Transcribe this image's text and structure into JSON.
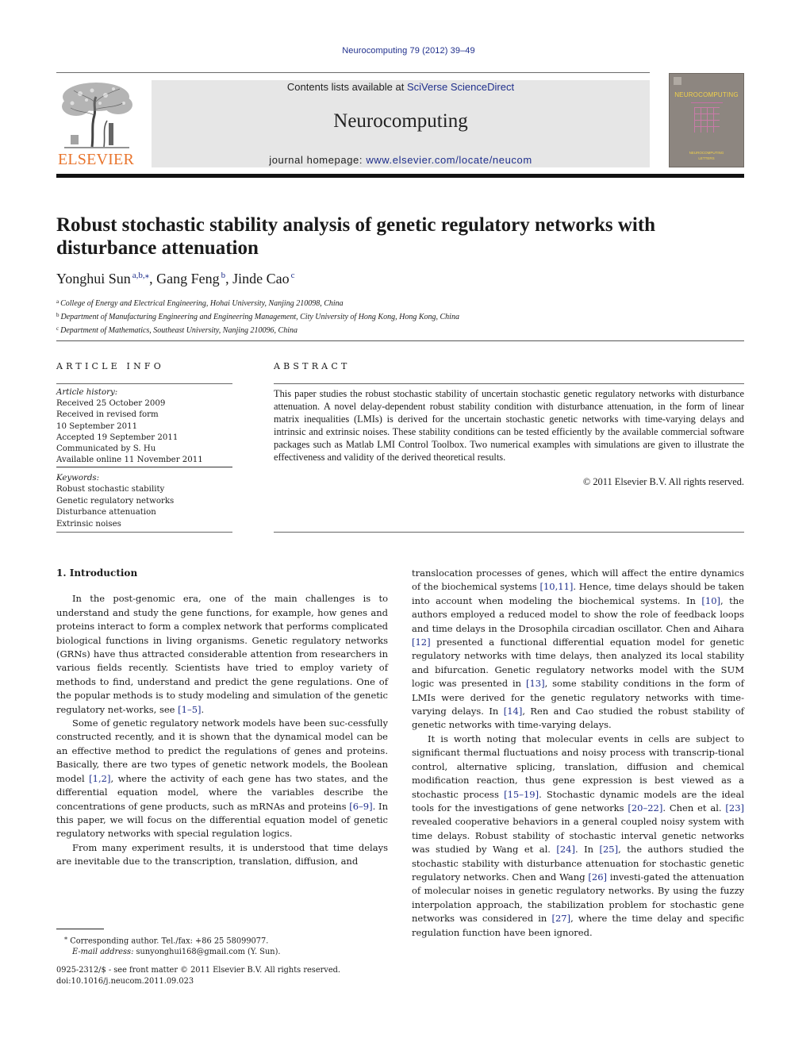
{
  "header": {
    "citation": "Neurocomputing 79 (2012) 39–49",
    "contents_prefix": "Contents lists available at ",
    "contents_link": "SciVerse ScienceDirect",
    "journal_name": "Neurocomputing",
    "homepage_prefix": "journal homepage: ",
    "homepage_link": "www.elsevier.com/locate/neucom",
    "publisher_logo_text": "ELSEVIER",
    "cover": {
      "title": "NEUROCOMPUTING",
      "subtitle_line1": "NEUROCOMPUTING",
      "subtitle_line2": "LETTERS"
    },
    "colors": {
      "link_blue": "#1f2f8c",
      "elsevier_orange": "#e8742c",
      "masthead_gray": "#e6e6e6"
    }
  },
  "article": {
    "title": "Robust stochastic stability analysis of genetic regulatory networks with disturbance attenuation",
    "authors": [
      {
        "name": "Yonghui Sun",
        "marks": "a,b,",
        "corresponding": "⁎"
      },
      {
        "name": "Gang Feng",
        "marks": "b"
      },
      {
        "name": "Jinde Cao",
        "marks": "c"
      }
    ],
    "affiliations": [
      {
        "mark": "a",
        "text": "College of Energy and Electrical Engineering, Hohai University, Nanjing 210098, China"
      },
      {
        "mark": "b",
        "text": "Department of Manufacturing Engineering and Engineering Management, City University of Hong Kong, Hong Kong, China"
      },
      {
        "mark": "c",
        "text": "Department of Mathematics, Southeast University, Nanjing 210096, China"
      }
    ]
  },
  "article_info": {
    "heading": "ARTICLE INFO",
    "history_label": "Article history:",
    "history": [
      "Received 25 October 2009",
      "Received in revised form",
      "10 September 2011",
      "Accepted 19 September 2011",
      "Communicated by S. Hu",
      "Available online 11 November 2011"
    ],
    "keywords_label": "Keywords:",
    "keywords": [
      "Robust stochastic stability",
      "Genetic regulatory networks",
      "Disturbance attenuation",
      "Extrinsic noises"
    ]
  },
  "abstract": {
    "heading": "ABSTRACT",
    "text": "This paper studies the robust stochastic stability of uncertain stochastic genetic regulatory networks with disturbance attenuation. A novel delay-dependent robust stability condition with disturbance attenuation, in the form of linear matrix inequalities (LMIs) is derived for the uncertain stochastic genetic networks with time-varying delays and intrinsic and extrinsic noises. These stability conditions can be tested efficiently by the available commercial software packages such as Matlab LMI Control Toolbox. Two numerical examples with simulations are given to illustrate the effectiveness and validity of the derived theoretical results.",
    "copyright": "© 2011 Elsevier B.V. All rights reserved."
  },
  "body": {
    "section_heading": "1.  Introduction",
    "left_paragraphs": [
      [
        {
          "t": "In the post-genomic era, one of the main challenges is to understand and study the gene functions, for example, how genes and proteins interact to form a complex network that performs complicated biological functions in living organisms. Genetic regulatory networks (GRNs) have thus attracted considerable attention from researchers in various fields recently. Scientists have tried to employ variety of methods to find, understand and predict the gene regulations. One of the popular methods is to study modeling and simulation of the genetic regulatory net-works, see "
        },
        {
          "ref": "[1–5]"
        },
        {
          "t": "."
        }
      ],
      [
        {
          "t": "Some of genetic regulatory network models have been suc-cessfully constructed recently, and it is shown that the dynamical model can be an effective method to predict the regulations of genes and proteins. Basically, there are two types of genetic network models, the Boolean model "
        },
        {
          "ref": "[1,2]"
        },
        {
          "t": ", where the activity of each gene has two states, and the differential equation model, where the variables describe the concentrations of gene products, such as mRNAs and proteins "
        },
        {
          "ref": "[6–9]"
        },
        {
          "t": ". In this paper, we will focus on the differential equation model of genetic regulatory networks with special regulation logics."
        }
      ],
      [
        {
          "t": "From many experiment results, it is understood that time delays are inevitable due to the transcription, translation, diffusion, and"
        }
      ]
    ],
    "right_paragraphs": [
      [
        {
          "t": "translocation processes of genes, which will affect the entire dynamics of the biochemical systems "
        },
        {
          "ref": "[10,11]"
        },
        {
          "t": ". Hence, time delays should be taken into account when modeling the biochemical systems. In "
        },
        {
          "ref": "[10]"
        },
        {
          "t": ", the authors employed a reduced model to show the role of feedback loops and time delays in the Drosophila circadian oscillator. Chen and Aihara "
        },
        {
          "ref": "[12]"
        },
        {
          "t": " presented a functional differential equation model for genetic regulatory networks with time delays, then analyzed its local stability and bifurcation. Genetic regulatory networks model with the SUM logic was presented in "
        },
        {
          "ref": "[13]"
        },
        {
          "t": ", some stability conditions in the form of LMIs were derived for the genetic regulatory networks with time-varying delays. In "
        },
        {
          "ref": "[14]"
        },
        {
          "t": ", Ren and Cao studied the robust stability of genetic networks with time-varying delays."
        }
      ],
      [
        {
          "t": "It is worth noting that molecular events in cells are subject to significant thermal fluctuations and noisy process with transcrip-tional control, alternative splicing, translation, diffusion and chemical modification reaction, thus gene expression is best viewed as a stochastic process "
        },
        {
          "ref": "[15–19]"
        },
        {
          "t": ". Stochastic dynamic models are the ideal tools for the investigations of gene networks "
        },
        {
          "ref": "[20–22]"
        },
        {
          "t": ". Chen et al. "
        },
        {
          "ref": "[23]"
        },
        {
          "t": " revealed cooperative behaviors in a general coupled noisy system with time delays. Robust stability of stochastic interval genetic networks was studied by Wang et al. "
        },
        {
          "ref": "[24]"
        },
        {
          "t": ". In "
        },
        {
          "ref": "[25]"
        },
        {
          "t": ", the authors studied the stochastic stability with disturbance attenuation for stochastic genetic regulatory networks. Chen and Wang "
        },
        {
          "ref": "[26]"
        },
        {
          "t": " investi-gated the attenuation of molecular noises in genetic regulatory networks. By using the fuzzy interpolation approach, the stabilization problem for stochastic gene networks was considered in "
        },
        {
          "ref": "[27]"
        },
        {
          "t": ", where the time delay and specific regulation function have been ignored."
        }
      ]
    ]
  },
  "footnotes": {
    "corresponding_mark": "⁎",
    "corresponding_text": "Corresponding author. Tel./fax: +86 25 58099077.",
    "email_label": "E-mail address:",
    "email_value": "sunyonghui168@gmail.com (Y. Sun).",
    "front_matter": "0925-2312/$ - see front matter © 2011 Elsevier B.V. All rights reserved.",
    "doi": "doi:10.1016/j.neucom.2011.09.023"
  }
}
